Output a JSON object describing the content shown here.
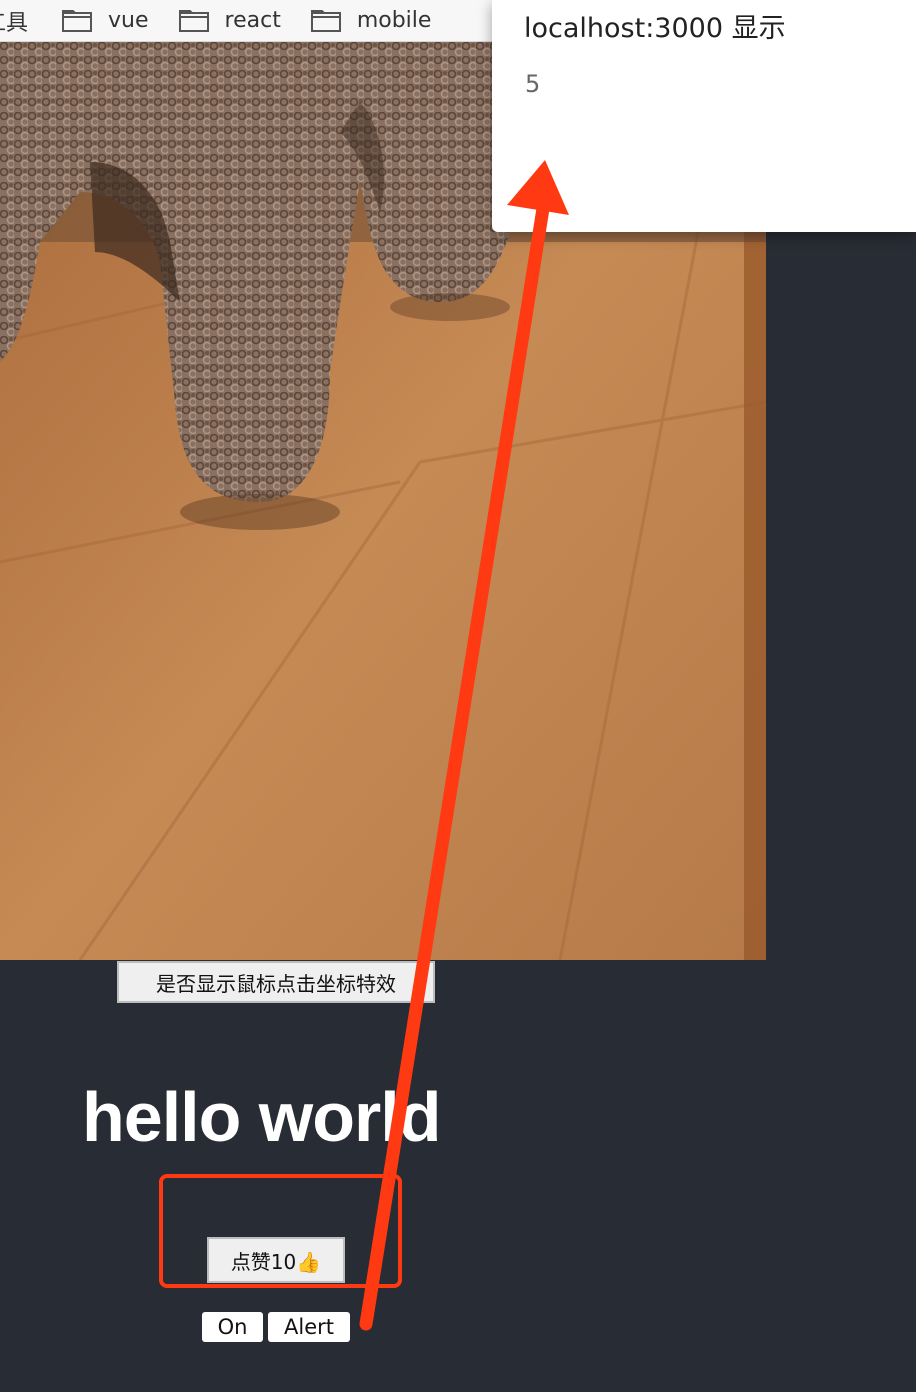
{
  "bookmarks_bar": {
    "items": [
      {
        "label": "工具"
      },
      {
        "label": "vue"
      },
      {
        "label": "react"
      },
      {
        "label": "mobile"
      }
    ]
  },
  "app": {
    "effect_toggle_label": "是否显示鼠标点击坐标特效",
    "heading": "hello world",
    "like_button_label": "点赞10👍",
    "on_button_label": "On",
    "alert_button_label": "Alert"
  },
  "alert_dialog": {
    "title": "localhost:3000 显示",
    "message": "5"
  },
  "colors": {
    "page_background": "#282c34",
    "annotation_red": "#ff3a12"
  }
}
